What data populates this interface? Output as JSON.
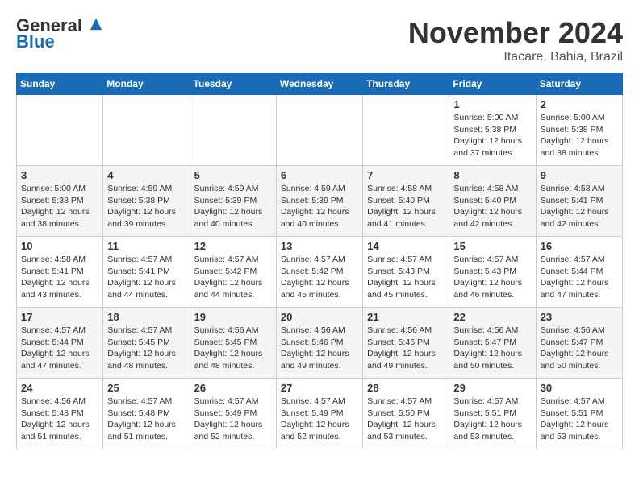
{
  "logo": {
    "line1": "General",
    "line2": "Blue"
  },
  "title": "November 2024",
  "subtitle": "Itacare, Bahia, Brazil",
  "weekdays": [
    "Sunday",
    "Monday",
    "Tuesday",
    "Wednesday",
    "Thursday",
    "Friday",
    "Saturday"
  ],
  "weeks": [
    [
      {
        "day": "",
        "info": ""
      },
      {
        "day": "",
        "info": ""
      },
      {
        "day": "",
        "info": ""
      },
      {
        "day": "",
        "info": ""
      },
      {
        "day": "",
        "info": ""
      },
      {
        "day": "1",
        "info": "Sunrise: 5:00 AM\nSunset: 5:38 PM\nDaylight: 12 hours\nand 37 minutes."
      },
      {
        "day": "2",
        "info": "Sunrise: 5:00 AM\nSunset: 5:38 PM\nDaylight: 12 hours\nand 38 minutes."
      }
    ],
    [
      {
        "day": "3",
        "info": "Sunrise: 5:00 AM\nSunset: 5:38 PM\nDaylight: 12 hours\nand 38 minutes."
      },
      {
        "day": "4",
        "info": "Sunrise: 4:59 AM\nSunset: 5:38 PM\nDaylight: 12 hours\nand 39 minutes."
      },
      {
        "day": "5",
        "info": "Sunrise: 4:59 AM\nSunset: 5:39 PM\nDaylight: 12 hours\nand 40 minutes."
      },
      {
        "day": "6",
        "info": "Sunrise: 4:59 AM\nSunset: 5:39 PM\nDaylight: 12 hours\nand 40 minutes."
      },
      {
        "day": "7",
        "info": "Sunrise: 4:58 AM\nSunset: 5:40 PM\nDaylight: 12 hours\nand 41 minutes."
      },
      {
        "day": "8",
        "info": "Sunrise: 4:58 AM\nSunset: 5:40 PM\nDaylight: 12 hours\nand 42 minutes."
      },
      {
        "day": "9",
        "info": "Sunrise: 4:58 AM\nSunset: 5:41 PM\nDaylight: 12 hours\nand 42 minutes."
      }
    ],
    [
      {
        "day": "10",
        "info": "Sunrise: 4:58 AM\nSunset: 5:41 PM\nDaylight: 12 hours\nand 43 minutes."
      },
      {
        "day": "11",
        "info": "Sunrise: 4:57 AM\nSunset: 5:41 PM\nDaylight: 12 hours\nand 44 minutes."
      },
      {
        "day": "12",
        "info": "Sunrise: 4:57 AM\nSunset: 5:42 PM\nDaylight: 12 hours\nand 44 minutes."
      },
      {
        "day": "13",
        "info": "Sunrise: 4:57 AM\nSunset: 5:42 PM\nDaylight: 12 hours\nand 45 minutes."
      },
      {
        "day": "14",
        "info": "Sunrise: 4:57 AM\nSunset: 5:43 PM\nDaylight: 12 hours\nand 45 minutes."
      },
      {
        "day": "15",
        "info": "Sunrise: 4:57 AM\nSunset: 5:43 PM\nDaylight: 12 hours\nand 46 minutes."
      },
      {
        "day": "16",
        "info": "Sunrise: 4:57 AM\nSunset: 5:44 PM\nDaylight: 12 hours\nand 47 minutes."
      }
    ],
    [
      {
        "day": "17",
        "info": "Sunrise: 4:57 AM\nSunset: 5:44 PM\nDaylight: 12 hours\nand 47 minutes."
      },
      {
        "day": "18",
        "info": "Sunrise: 4:57 AM\nSunset: 5:45 PM\nDaylight: 12 hours\nand 48 minutes."
      },
      {
        "day": "19",
        "info": "Sunrise: 4:56 AM\nSunset: 5:45 PM\nDaylight: 12 hours\nand 48 minutes."
      },
      {
        "day": "20",
        "info": "Sunrise: 4:56 AM\nSunset: 5:46 PM\nDaylight: 12 hours\nand 49 minutes."
      },
      {
        "day": "21",
        "info": "Sunrise: 4:56 AM\nSunset: 5:46 PM\nDaylight: 12 hours\nand 49 minutes."
      },
      {
        "day": "22",
        "info": "Sunrise: 4:56 AM\nSunset: 5:47 PM\nDaylight: 12 hours\nand 50 minutes."
      },
      {
        "day": "23",
        "info": "Sunrise: 4:56 AM\nSunset: 5:47 PM\nDaylight: 12 hours\nand 50 minutes."
      }
    ],
    [
      {
        "day": "24",
        "info": "Sunrise: 4:56 AM\nSunset: 5:48 PM\nDaylight: 12 hours\nand 51 minutes."
      },
      {
        "day": "25",
        "info": "Sunrise: 4:57 AM\nSunset: 5:48 PM\nDaylight: 12 hours\nand 51 minutes."
      },
      {
        "day": "26",
        "info": "Sunrise: 4:57 AM\nSunset: 5:49 PM\nDaylight: 12 hours\nand 52 minutes."
      },
      {
        "day": "27",
        "info": "Sunrise: 4:57 AM\nSunset: 5:49 PM\nDaylight: 12 hours\nand 52 minutes."
      },
      {
        "day": "28",
        "info": "Sunrise: 4:57 AM\nSunset: 5:50 PM\nDaylight: 12 hours\nand 53 minutes."
      },
      {
        "day": "29",
        "info": "Sunrise: 4:57 AM\nSunset: 5:51 PM\nDaylight: 12 hours\nand 53 minutes."
      },
      {
        "day": "30",
        "info": "Sunrise: 4:57 AM\nSunset: 5:51 PM\nDaylight: 12 hours\nand 53 minutes."
      }
    ]
  ]
}
